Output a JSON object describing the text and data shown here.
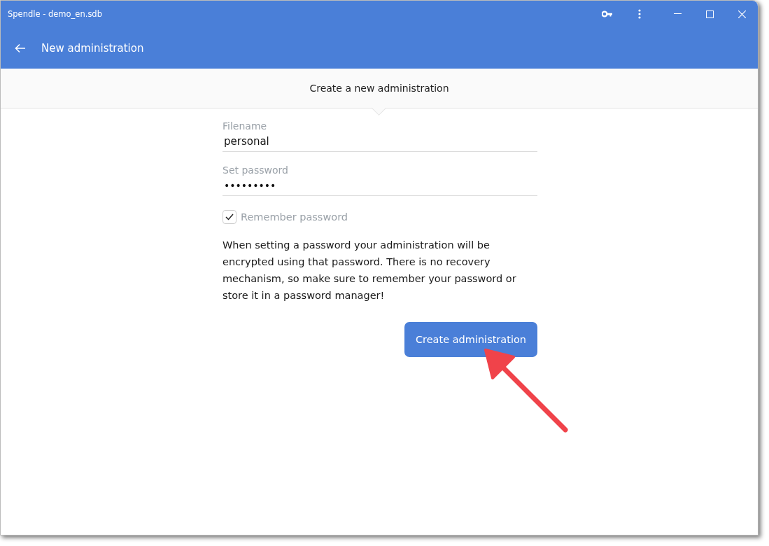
{
  "window": {
    "title": "Spendle - demo_en.sdb"
  },
  "header": {
    "title": "New administration"
  },
  "section": {
    "title": "Create a new administration"
  },
  "fields": [
    {
      "label": "Filename",
      "value": "personal",
      "kind": "text"
    },
    {
      "label": "Set password",
      "value": "•••••••••",
      "kind": "password"
    }
  ],
  "remember": {
    "label": "Remember password",
    "checked": true
  },
  "notice": "When setting a password your administration will be encrypted using that password. There is no recovery mechanism, so make sure to remember your password or store it in a password manager!",
  "buttons": [
    "Create administration"
  ]
}
